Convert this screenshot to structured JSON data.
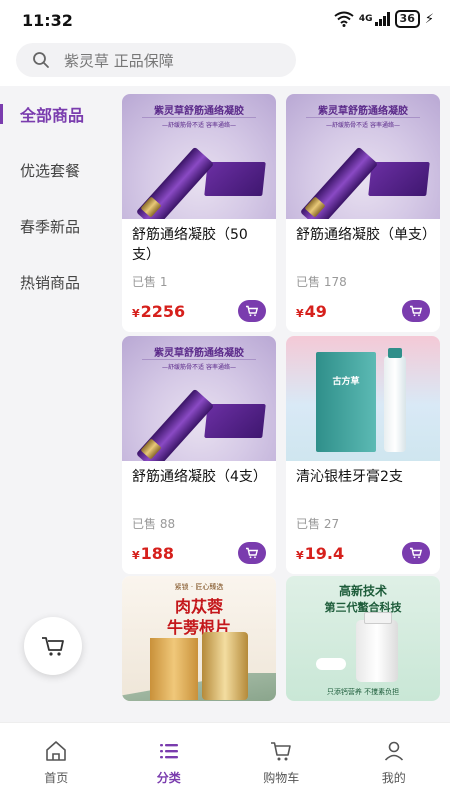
{
  "status": {
    "time": "11:32",
    "network": "4G",
    "battery": "36"
  },
  "search": {
    "placeholder": "紫灵草 正品保障"
  },
  "sidebar": {
    "items": [
      {
        "label": "全部商品"
      },
      {
        "label": "优选套餐"
      },
      {
        "label": "春季新品"
      },
      {
        "label": "热销商品"
      }
    ]
  },
  "products": [
    {
      "title": "舒筋通络凝胶（50支）",
      "sold": "已售 1",
      "currency": "¥",
      "price": "2256",
      "image_text": {
        "brand": "紫灵草舒筋通络凝胶",
        "slogan": "—舒缓筋骨不适 容率通络—"
      }
    },
    {
      "title": "舒筋通络凝胶（单支）",
      "sold": "已售 178",
      "currency": "¥",
      "price": "49",
      "image_text": {
        "brand": "紫灵草舒筋通络凝胶",
        "slogan": "—舒缓筋骨不适 容率通络—"
      }
    },
    {
      "title": "舒筋通络凝胶（4支）",
      "sold": "已售 88",
      "currency": "¥",
      "price": "188",
      "image_text": {
        "brand": "紫灵草舒筋通络凝胶",
        "slogan": "—舒缓筋骨不适 容率通络—"
      }
    },
    {
      "title": "清沁银桂牙膏2支",
      "sold": "已售 27",
      "currency": "¥",
      "price": "19.4",
      "image_text": {
        "label": "古方草"
      }
    },
    {
      "title": "",
      "sold": "",
      "currency": "",
      "price": "",
      "image_text": {
        "small": "紧锁 · 匠心臻选",
        "line1": "肉苁蓉",
        "line2": "牛蒡根片"
      }
    },
    {
      "title": "",
      "sold": "",
      "currency": "",
      "price": "",
      "image_text": {
        "line1": "高新技术",
        "line2": "第三代螯合科技",
        "foot": "只添钙营养  不搅素负担"
      }
    }
  ],
  "tabbar": {
    "items": [
      {
        "label": "首页"
      },
      {
        "label": "分类"
      },
      {
        "label": "购物车"
      },
      {
        "label": "我的"
      }
    ],
    "active": "分类"
  },
  "colors": {
    "accent": "#7a3cae",
    "price": "#d6201c"
  }
}
